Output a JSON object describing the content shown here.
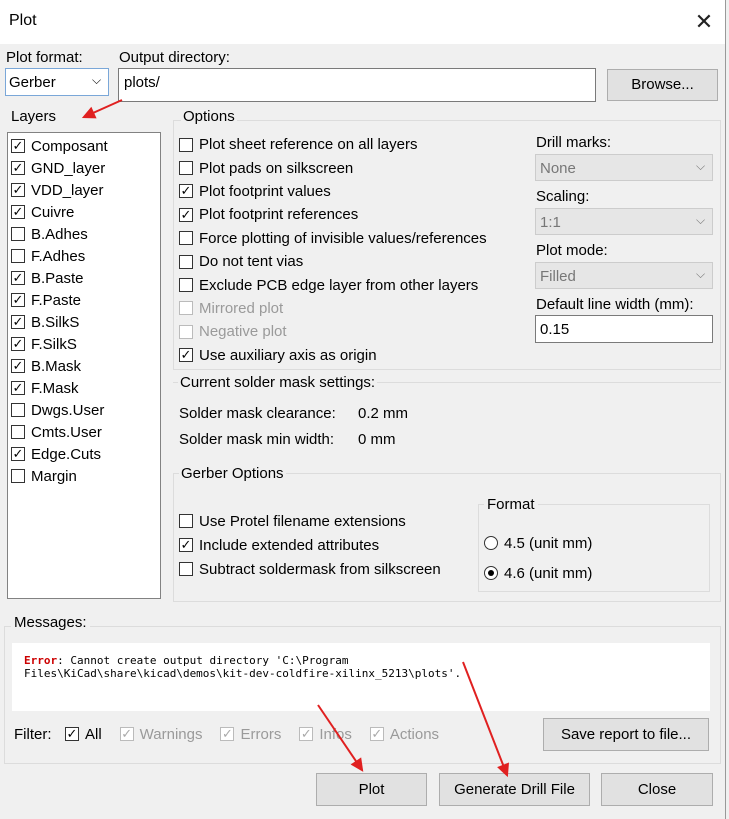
{
  "window": {
    "title": "Plot"
  },
  "plot_format": {
    "label": "Plot format:",
    "value": "Gerber"
  },
  "output_dir": {
    "label": "Output directory:",
    "value": "plots/",
    "browse": "Browse..."
  },
  "layers": {
    "title": "Layers",
    "items": [
      {
        "label": "Composant",
        "checked": true
      },
      {
        "label": "GND_layer",
        "checked": true
      },
      {
        "label": "VDD_layer",
        "checked": true
      },
      {
        "label": "Cuivre",
        "checked": true
      },
      {
        "label": "B.Adhes",
        "checked": false
      },
      {
        "label": "F.Adhes",
        "checked": false
      },
      {
        "label": "B.Paste",
        "checked": true
      },
      {
        "label": "F.Paste",
        "checked": true
      },
      {
        "label": "B.SilkS",
        "checked": true
      },
      {
        "label": "F.SilkS",
        "checked": true
      },
      {
        "label": "B.Mask",
        "checked": true
      },
      {
        "label": "F.Mask",
        "checked": true
      },
      {
        "label": "Dwgs.User",
        "checked": false
      },
      {
        "label": "Cmts.User",
        "checked": false
      },
      {
        "label": "Edge.Cuts",
        "checked": true
      },
      {
        "label": "Margin",
        "checked": false
      }
    ]
  },
  "options": {
    "title": "Options",
    "items": [
      {
        "label": "Plot sheet reference on all layers",
        "checked": false,
        "disabled": false
      },
      {
        "label": "Plot pads on silkscreen",
        "checked": false,
        "disabled": false
      },
      {
        "label": "Plot footprint values",
        "checked": true,
        "disabled": false
      },
      {
        "label": "Plot footprint references",
        "checked": true,
        "disabled": false
      },
      {
        "label": "Force plotting of invisible values/references",
        "checked": false,
        "disabled": false
      },
      {
        "label": "Do not tent vias",
        "checked": false,
        "disabled": false
      },
      {
        "label": "Exclude PCB edge layer from other layers",
        "checked": false,
        "disabled": false
      },
      {
        "label": "Mirrored plot",
        "checked": false,
        "disabled": true
      },
      {
        "label": "Negative plot",
        "checked": false,
        "disabled": true
      },
      {
        "label": "Use auxiliary axis as origin",
        "checked": true,
        "disabled": false
      }
    ],
    "drill_marks": {
      "label": "Drill marks:",
      "value": "None"
    },
    "scaling": {
      "label": "Scaling:",
      "value": "1:1"
    },
    "plot_mode": {
      "label": "Plot mode:",
      "value": "Filled"
    },
    "line_width": {
      "label": "Default line width (mm):",
      "value": "0.15"
    }
  },
  "solder": {
    "title": "Current solder mask settings:",
    "clearance_label": "Solder mask clearance:",
    "clearance_value": "0.2 mm",
    "minwidth_label": "Solder mask min width:",
    "minwidth_value": "0 mm"
  },
  "gerber": {
    "title": "Gerber Options",
    "items": [
      {
        "label": "Use Protel filename extensions",
        "checked": false
      },
      {
        "label": "Include extended attributes",
        "checked": true
      },
      {
        "label": "Subtract soldermask from silkscreen",
        "checked": false
      }
    ],
    "format_title": "Format",
    "formats": [
      {
        "label": "4.5 (unit mm)",
        "selected": false
      },
      {
        "label": "4.6 (unit mm)",
        "selected": true
      }
    ]
  },
  "messages": {
    "title": "Messages:",
    "error_tag": "Error",
    "error_text": ": Cannot create output directory 'C:\\Program",
    "error_text2": "Files\\KiCad\\share\\kicad\\demos\\kit-dev-coldfire-xilinx_5213\\plots'.",
    "error_color": "#cc0000"
  },
  "filter": {
    "label": "Filter:",
    "items": [
      {
        "label": "All",
        "checked": true,
        "disabled": false
      },
      {
        "label": "Warnings",
        "checked": true,
        "disabled": true
      },
      {
        "label": "Errors",
        "checked": true,
        "disabled": true
      },
      {
        "label": "Infos",
        "checked": true,
        "disabled": true
      },
      {
        "label": "Actions",
        "checked": true,
        "disabled": true
      }
    ],
    "save_report": "Save report to file..."
  },
  "buttons": {
    "plot": "Plot",
    "drill": "Generate Drill File",
    "close": "Close"
  },
  "annotation_color": "#e02020"
}
